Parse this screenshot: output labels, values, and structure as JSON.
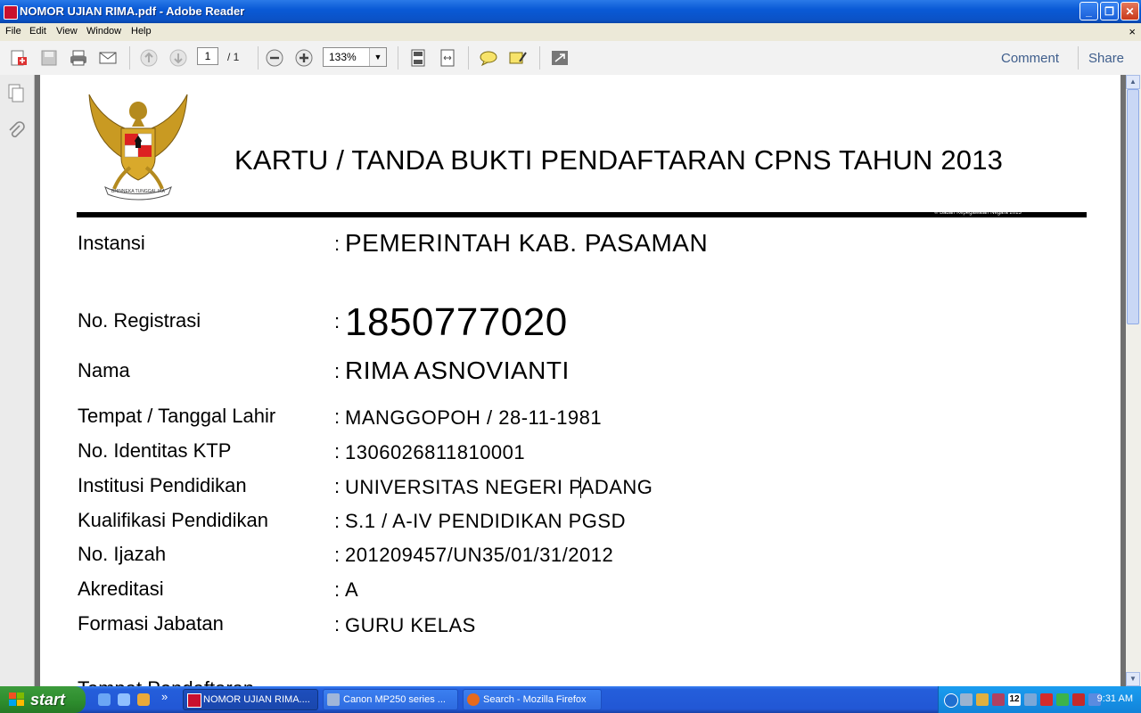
{
  "window": {
    "title": "NOMOR UJIAN RIMA.pdf - Adobe Reader",
    "controls": {
      "minimize": "_",
      "maximize": "❐",
      "close": "✕"
    }
  },
  "menu": {
    "items": [
      "File",
      "Edit",
      "View",
      "Window",
      "Help"
    ],
    "close_glyph": "×"
  },
  "toolbar": {
    "page_current": "1",
    "page_total": "/ 1",
    "zoom": "133%",
    "zoom_dropdown_glyph": "▼",
    "comment_label": "Comment",
    "share_label": "Share"
  },
  "document": {
    "title": "KARTU / TANDA BUKTI PENDAFTARAN CPNS TAHUN 2013",
    "copyright": "© Badan Kepegawaian Negara 2013",
    "emblem_text": "BHINNEKA TUNGGAL IKA",
    "fields": [
      {
        "label": "Instansi",
        "value": "PEMERINTAH KAB. PASAMAN"
      },
      {
        "label": "No. Registrasi",
        "value": "1850777020"
      },
      {
        "label": "Nama",
        "value": "RIMA ASNOVIANTI"
      },
      {
        "label": "Tempat / Tanggal Lahir",
        "value": "MANGGOPOH / 28-11-1981"
      },
      {
        "label": "No. Identitas KTP",
        "value": "1306026811810001"
      },
      {
        "label": "Institusi Pendidikan",
        "value": "UNIVERSITAS NEGERI PADANG"
      },
      {
        "label": "Kualifikasi Pendidikan",
        "value": "S.1 / A-IV PENDIDIKAN PGSD"
      },
      {
        "label": "No. Ijazah",
        "value": "201209457/UN35/01/31/2012"
      },
      {
        "label": "Akreditasi",
        "value": "A"
      },
      {
        "label": "Formasi Jabatan",
        "value": "GURU KELAS"
      }
    ],
    "colon": ":",
    "cut_off_text": "Tempat Pendaftaran"
  },
  "taskbar": {
    "start_label": "start",
    "overflow": "»",
    "tasks": [
      {
        "label": "NOMOR UJIAN RIMA....",
        "active": true
      },
      {
        "label": "Canon MP250 series ...",
        "active": false
      },
      {
        "label": "Search - Mozilla Firefox",
        "active": false
      }
    ],
    "tray_badge": "12",
    "clock": "9:31 AM"
  },
  "colors": {
    "title_blue": "#0a5ad6",
    "taskbar_blue": "#245edb",
    "start_green": "#2d8c2d",
    "link_blue": "#3f5e8c"
  },
  "icons": [
    "pdf-icon",
    "create-pdf-icon",
    "save-icon",
    "print-icon",
    "email-icon",
    "previous-page-icon",
    "next-page-icon",
    "zoom-out-icon",
    "zoom-in-icon",
    "fit-page-icon",
    "fit-width-icon",
    "comment-bubble-icon",
    "highlight-icon",
    "expand-icon",
    "pages-panel-icon",
    "attachments-icon"
  ]
}
